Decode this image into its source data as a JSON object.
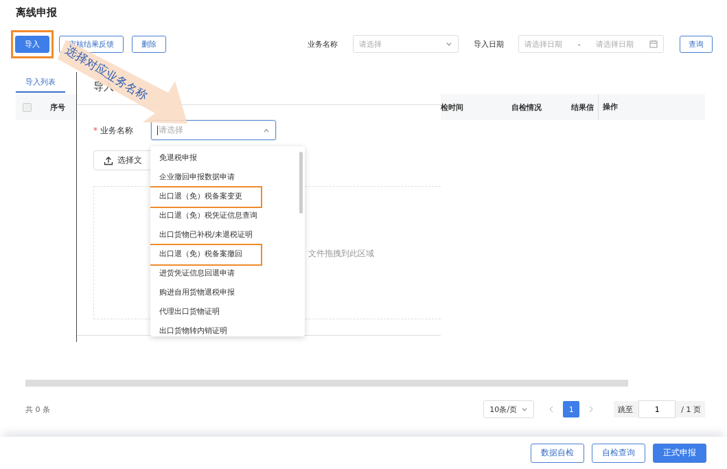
{
  "page_title": "离线申报",
  "toolbar": {
    "buttons": [
      {
        "label": "导入",
        "kind": "primary",
        "highlighted": true
      },
      {
        "label": "审核结果反馈",
        "kind": "outline",
        "highlighted": false
      },
      {
        "label": "删除",
        "kind": "outline",
        "highlighted": false
      }
    ],
    "filters": {
      "business_label": "业务名称",
      "business_placeholder": "请选择",
      "date_label": "导入日期",
      "date_start_placeholder": "请选择日期",
      "date_separator": "-",
      "date_end_placeholder": "请选择日期",
      "query_button": "查询"
    }
  },
  "tabs": [
    {
      "label": "导入列表",
      "selected": true
    }
  ],
  "table": {
    "select_all_checked": false,
    "columns": [
      "序号",
      "检时间",
      "自检情况",
      "结果信",
      "操作"
    ]
  },
  "pagination": {
    "total": "共 0 条",
    "page_size": "10条/页",
    "pages": [
      {
        "label": "1",
        "selected": true
      }
    ],
    "jump_label": "跳至",
    "jump_value": "1",
    "page_count": "/ 1 页"
  },
  "footer_buttons": [
    {
      "label": "数据自检",
      "kind": "outline"
    },
    {
      "label": "自检查询",
      "kind": "outline"
    },
    {
      "label": "正式申报",
      "kind": "primary"
    }
  ],
  "dialog": {
    "title": "导入",
    "field_label": "业务名称",
    "required": true,
    "required_mark": "*",
    "select_placeholder": "请选择",
    "open": true,
    "upload_button": "选择文",
    "drop_hint": "文件拖拽到此区域",
    "options": [
      {
        "label": "免退税申报",
        "highlighted": false
      },
      {
        "label": "企业撤回申报数据申请",
        "highlighted": false
      },
      {
        "label": "出口退（免）税备案变更",
        "highlighted": true
      },
      {
        "label": "出口退（免）税凭证信息查询",
        "highlighted": false
      },
      {
        "label": "出口货物已补税/未退税证明",
        "highlighted": false
      },
      {
        "label": "出口退（免）税备案撤回",
        "highlighted": true
      },
      {
        "label": "进货凭证信息回退申请",
        "highlighted": false
      },
      {
        "label": "购进自用货物退税申报",
        "highlighted": false
      },
      {
        "label": "代理出口货物证明",
        "highlighted": false
      },
      {
        "label": "出口货物转内销证明",
        "highlighted": false
      }
    ]
  },
  "annotation": {
    "text": "选择对应业务名称"
  }
}
